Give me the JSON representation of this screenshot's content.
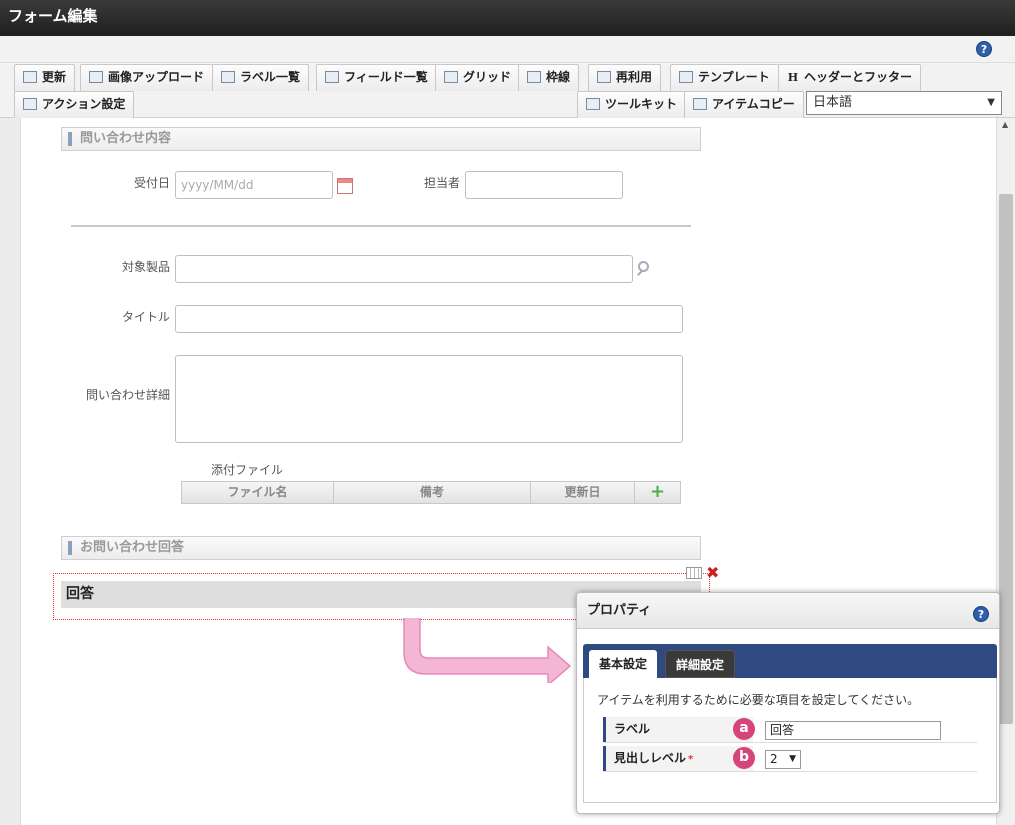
{
  "window": {
    "title": "フォーム編集"
  },
  "toolbar": {
    "row1": [
      "更新",
      "画像アップロード",
      "ラベル一覧",
      "フィールド一覧",
      "グリッド",
      "枠線",
      "再利用",
      "テンプレート",
      "ヘッダーとフッター"
    ],
    "action_settings": "アクション設定",
    "toolkit": "ツールキット",
    "item_copy": "アイテムコピー",
    "language": "日本語"
  },
  "form": {
    "section1_title": "問い合わせ内容",
    "received_date": {
      "label": "受付日",
      "placeholder": "yyyy/MM/dd"
    },
    "assignee": {
      "label": "担当者"
    },
    "target_product": {
      "label": "対象製品"
    },
    "title": {
      "label": "タイトル"
    },
    "details": {
      "label": "問い合わせ詳細"
    },
    "attachments": {
      "label": "添付ファイル",
      "columns": [
        "ファイル名",
        "備考",
        "更新日"
      ]
    },
    "section2_title": "お問い合わせ回答",
    "heading_item": "回答"
  },
  "properties": {
    "title": "プロパティ",
    "tabs": {
      "basic": "基本設定",
      "advanced": "詳細設定"
    },
    "description": "アイテムを利用するために必要な項目を設定してください。",
    "label_row": {
      "label": "ラベル",
      "marker": "a",
      "value": "回答"
    },
    "level_row": {
      "label": "見出しレベル",
      "required": "*",
      "marker": "b",
      "value": "2"
    }
  },
  "icons": {
    "help": "help-icon",
    "calendar": "calendar-icon",
    "search": "search-icon",
    "add": "plus-icon",
    "delete": "close-icon"
  },
  "colors": {
    "title_bar": "#2a2a2a",
    "tab_strip": "#2f4a80",
    "marker": "#d6457a",
    "arrow": "#f0a0c8",
    "delete": "#cc1f1f"
  }
}
